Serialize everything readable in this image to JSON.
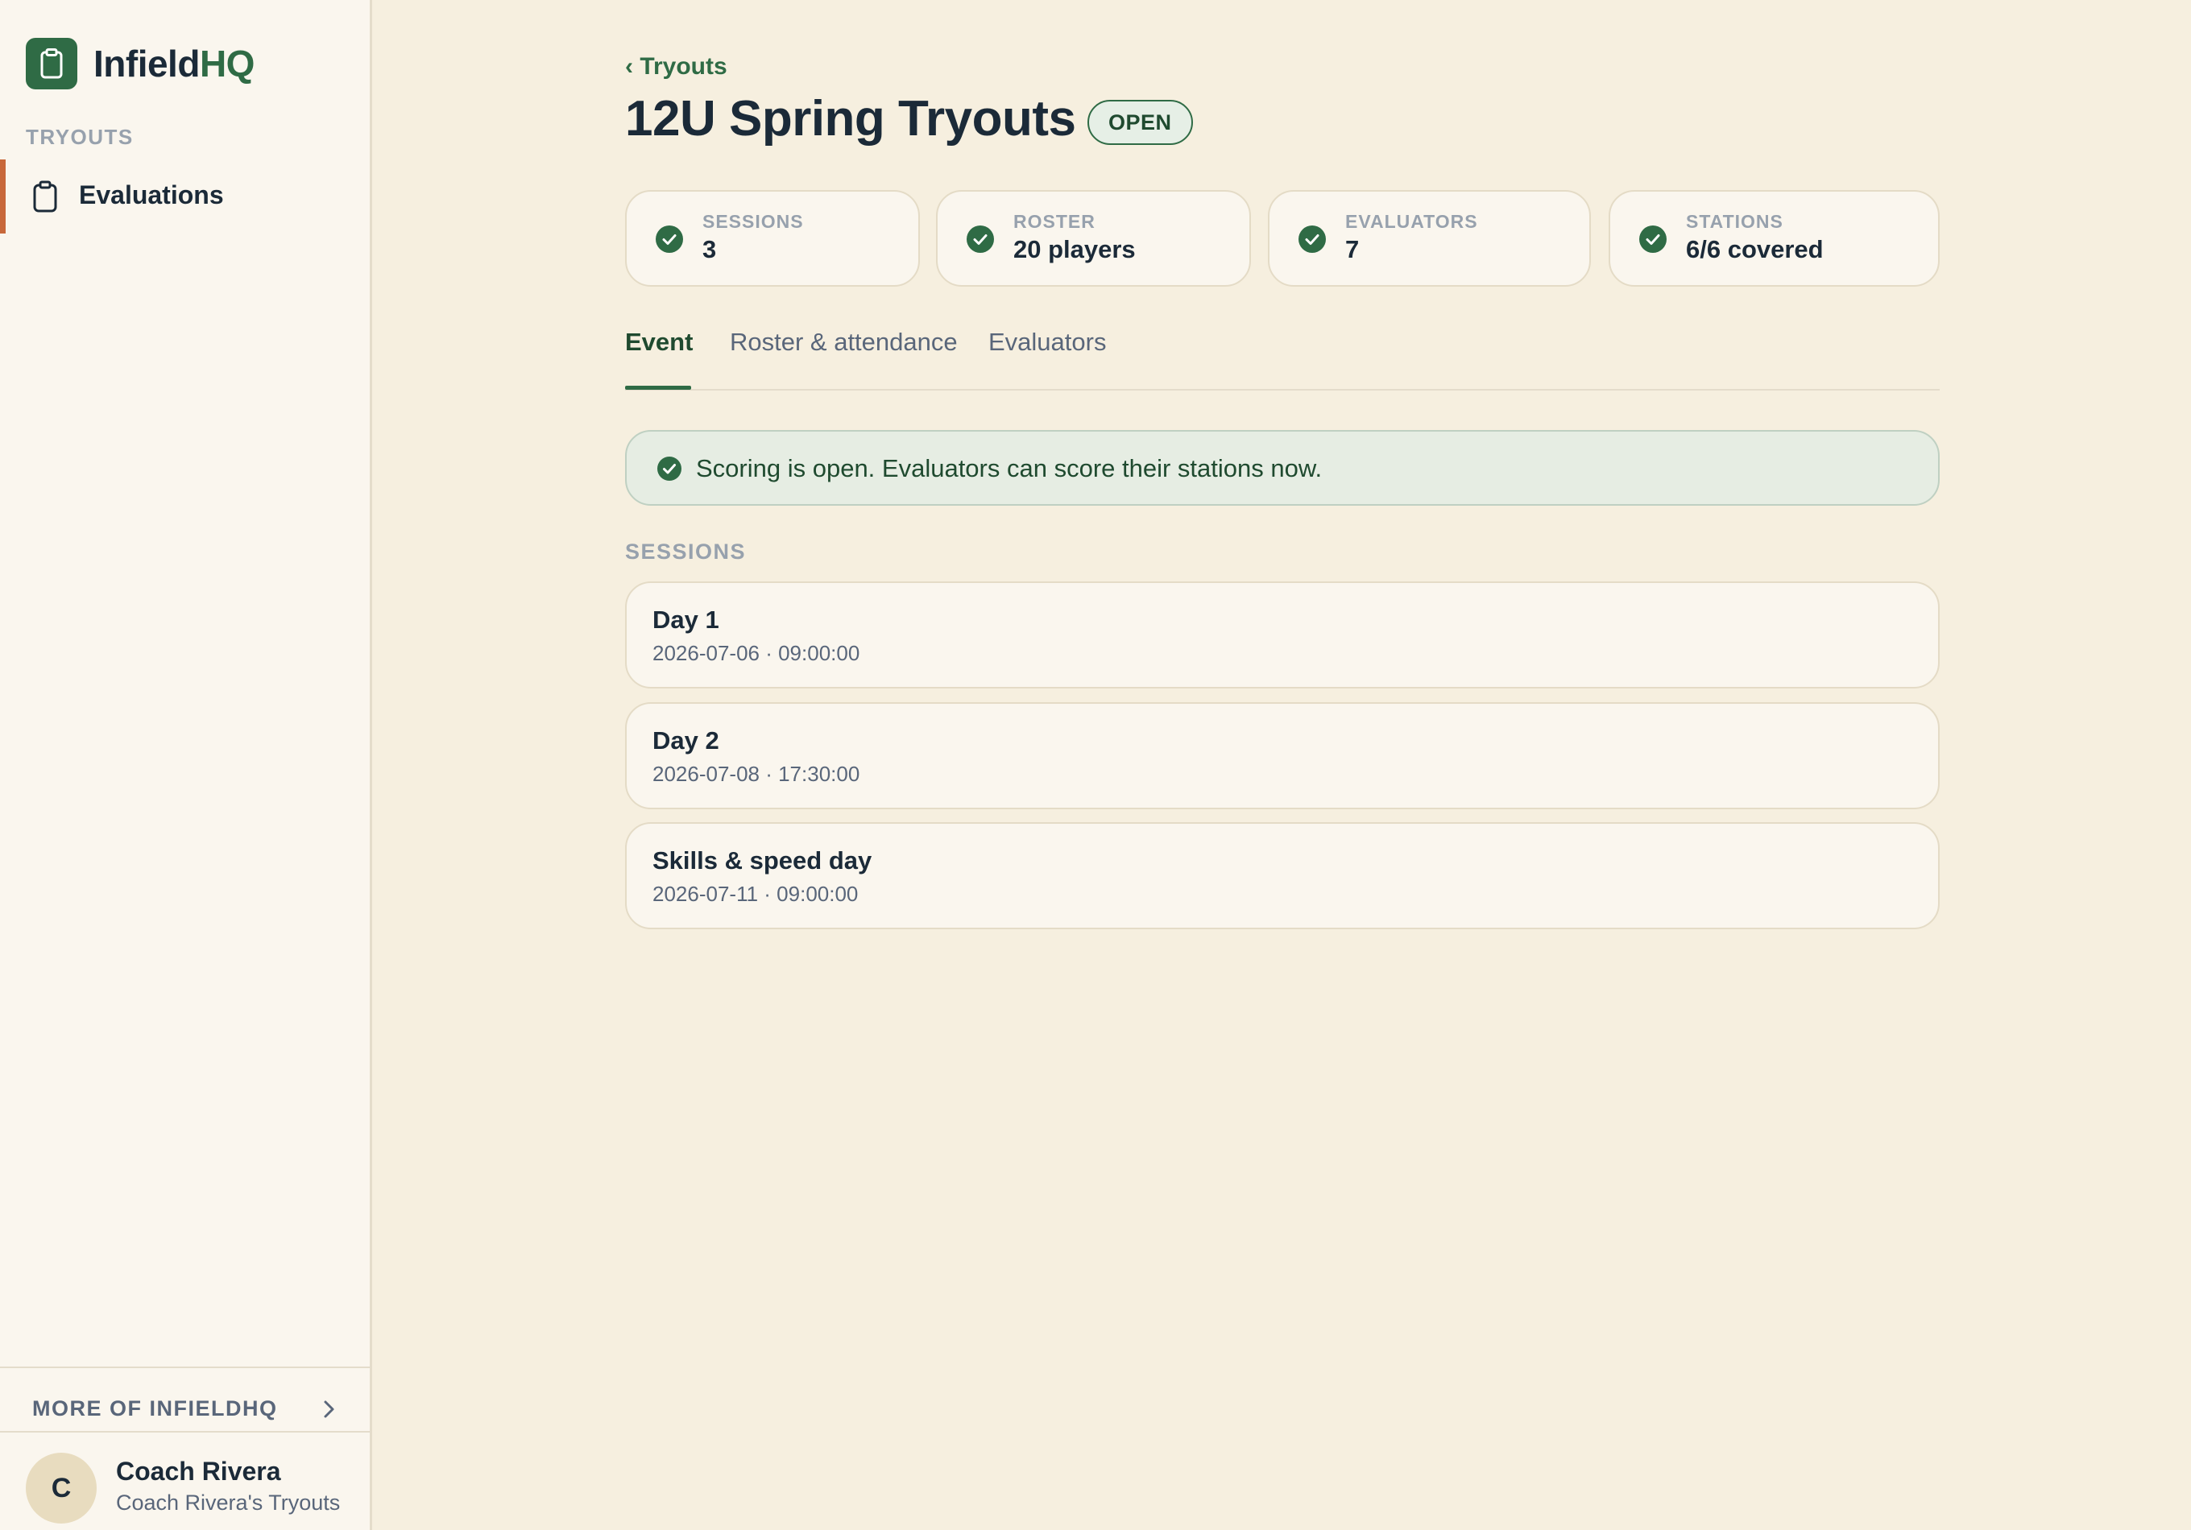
{
  "brand": {
    "name_main": "Infield",
    "name_accent": "HQ",
    "logo_icon": "clipboard-icon"
  },
  "sidebar": {
    "section_label": "TRYOUTS",
    "items": [
      {
        "label": "Evaluations",
        "icon": "clipboard-icon",
        "active": true
      }
    ],
    "more_label": "MORE OF INFIELDHQ",
    "user": {
      "initial": "C",
      "name": "Coach Rivera",
      "subtitle": "Coach Rivera's Tryouts"
    }
  },
  "header": {
    "back_label": "‹ Tryouts",
    "title": "12U Spring Tryouts",
    "status": "OPEN"
  },
  "stats": [
    {
      "label": "SESSIONS",
      "value": "3"
    },
    {
      "label": "ROSTER",
      "value": "20 players"
    },
    {
      "label": "EVALUATORS",
      "value": "7"
    },
    {
      "label": "STATIONS",
      "value": "6/6 covered"
    }
  ],
  "tabs": [
    {
      "label": "Event",
      "active": true
    },
    {
      "label": "Roster & attendance",
      "active": false
    },
    {
      "label": "Evaluators",
      "active": false
    }
  ],
  "alert": {
    "text": "Scoring is open. Evaluators can score their stations now."
  },
  "sessions": {
    "label": "SESSIONS",
    "items": [
      {
        "name": "Day 1",
        "meta": "2026-07-06 · 09:00:00"
      },
      {
        "name": "Day 2",
        "meta": "2026-07-08 · 17:30:00"
      },
      {
        "name": "Skills & speed day",
        "meta": "2026-07-11 · 09:00:00"
      }
    ]
  },
  "colors": {
    "brand_green": "#2f6b45",
    "active_accent": "#c8683a",
    "page_bg": "#f6efdf",
    "sidebar_bg": "#faf6ee"
  }
}
